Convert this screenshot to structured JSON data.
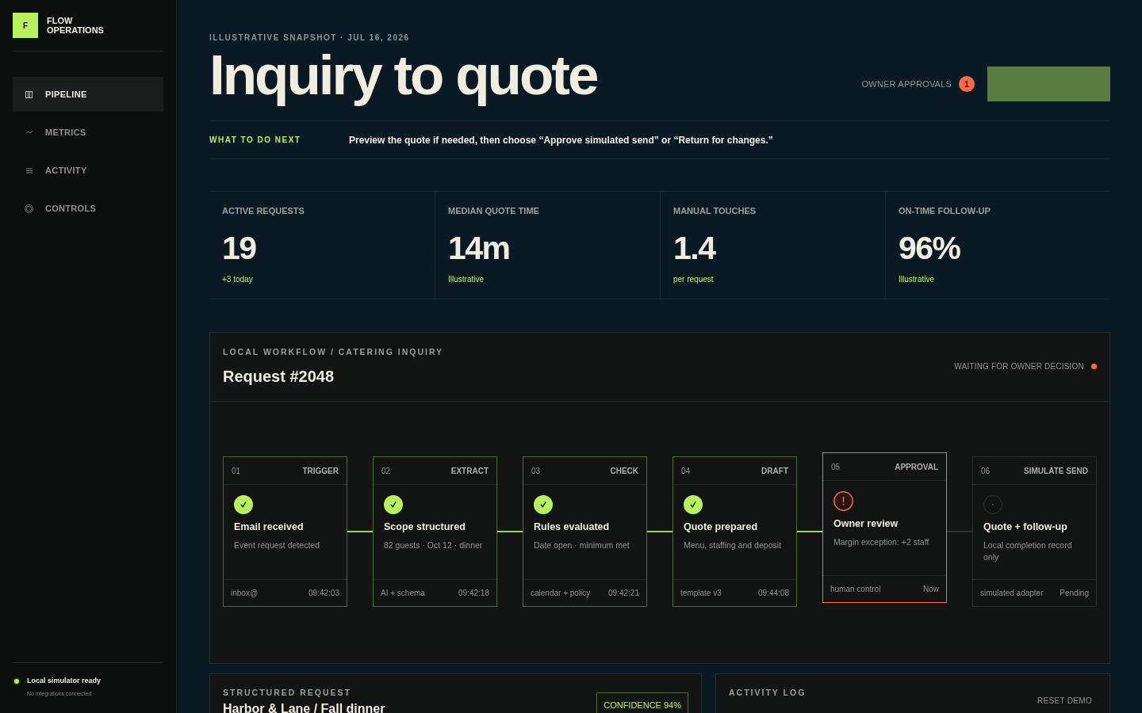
{
  "sidebar": {
    "brand": {
      "mark": "F",
      "name": "FLOW OPERATIONS"
    },
    "nav_items": [
      {
        "label": "PIPELINE",
        "selected": true
      },
      {
        "label": "METRICS",
        "selected": false
      },
      {
        "label": "ACTIVITY",
        "selected": false
      },
      {
        "label": "CONTROLS",
        "selected": false
      }
    ],
    "status": {
      "title": "Local simulator ready",
      "detail": "No integrations connected"
    }
  },
  "header": {
    "eyebrow": "ILLUSTRATIVE SNAPSHOT · JUL 16, 2026",
    "title": "Inquiry to quote",
    "approvals": {
      "label": "OWNER APPROVALS",
      "count": "1"
    }
  },
  "next_step": {
    "label": "WHAT TO DO NEXT",
    "text": "Preview the quote if needed, then choose “Approve simulated send” or “Return for changes.”"
  },
  "metrics": [
    {
      "label": "ACTIVE REQUESTS",
      "value": "19",
      "note": "+3 today"
    },
    {
      "label": "MEDIAN QUOTE TIME",
      "value": "14m",
      "note": "Illustrative"
    },
    {
      "label": "MANUAL TOUCHES",
      "value": "1.4",
      "note": "per request"
    },
    {
      "label": "ON-TIME FOLLOW-UP",
      "value": "96%",
      "note": "Illustrative"
    }
  ],
  "workflow": {
    "eyebrow": "LOCAL WORKFLOW / CATERING INQUIRY",
    "title": "Request #2048",
    "status": "WAITING FOR OWNER DECISION",
    "steps": [
      {
        "kind": "done",
        "number": "01",
        "type": "TRIGGER",
        "title": "Email received",
        "detail": "Event request detected",
        "source": "inbox@",
        "time": "09:42:03"
      },
      {
        "kind": "done",
        "number": "02",
        "type": "EXTRACT",
        "title": "Scope structured",
        "detail": "82 guests · Oct 12 · dinner",
        "source": "AI + schema",
        "time": "09:42:18"
      },
      {
        "kind": "done",
        "number": "03",
        "type": "CHECK",
        "title": "Rules evaluated",
        "detail": "Date open · minimum met",
        "source": "calendar + policy",
        "time": "09:42:21"
      },
      {
        "kind": "done",
        "number": "04",
        "type": "DRAFT",
        "title": "Quote prepared",
        "detail": "Menu, staffing and deposit",
        "source": "template v3",
        "time": "09:44:08"
      },
      {
        "kind": "active",
        "number": "05",
        "type": "APPROVAL",
        "title": "Owner review",
        "detail": "Margin exception: +2 staff",
        "source": "human control",
        "time": "Now"
      },
      {
        "kind": "pending",
        "number": "06",
        "type": "SIMULATE SEND",
        "title": "Quote + follow-up",
        "detail": "Local completion record only",
        "source": "simulated adapter",
        "time": "Pending"
      }
    ]
  },
  "structured_request": {
    "eyebrow": "STRUCTURED REQUEST",
    "title": "Harbor & Lane / Fall dinner",
    "confidence": "CONFIDENCE 94%"
  },
  "activity_log": {
    "title": "ACTIVITY LOG",
    "reset": "RESET DEMO"
  }
}
